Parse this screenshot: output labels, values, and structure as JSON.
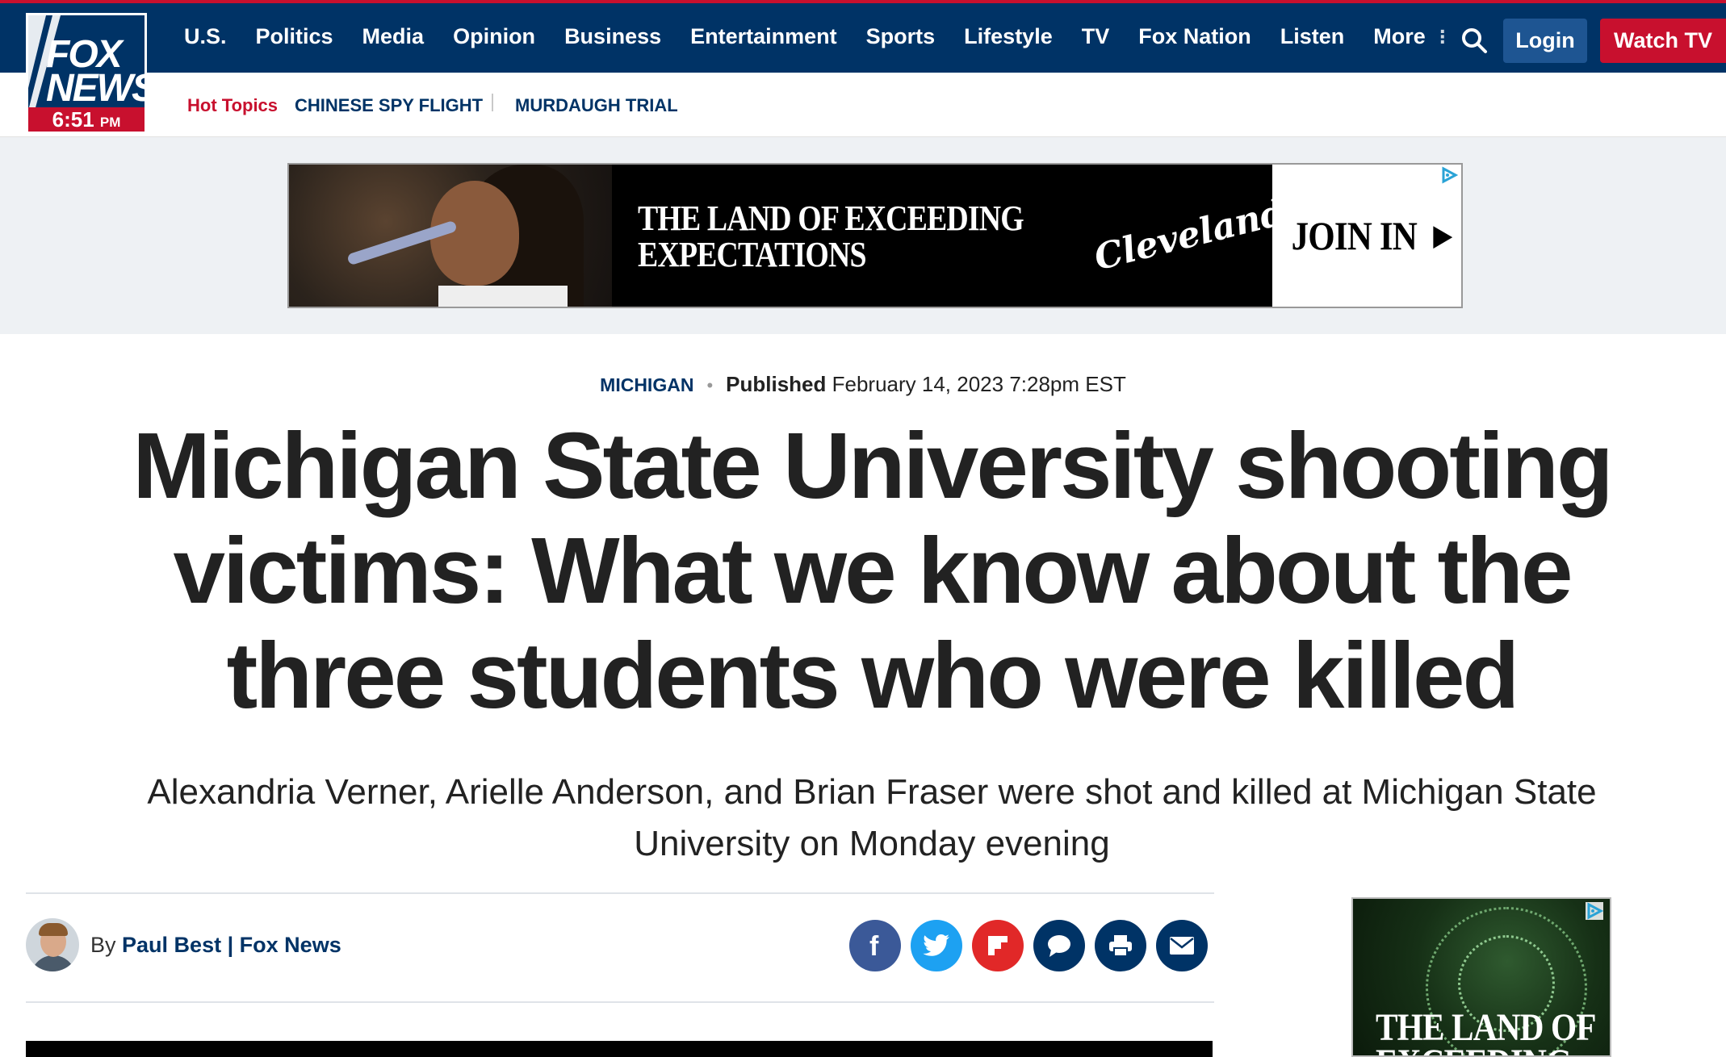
{
  "logo": {
    "line1": "FOX",
    "line2": "NEWS",
    "time": "6:51",
    "ampm": "PM"
  },
  "nav": {
    "items": [
      "U.S.",
      "Politics",
      "Media",
      "Opinion",
      "Business",
      "Entertainment",
      "Sports",
      "Lifestyle",
      "TV",
      "Fox Nation",
      "Listen",
      "More"
    ],
    "login": "Login",
    "watch_tv": "Watch TV",
    "search_icon": "search-icon",
    "more_icon": "vertical-dots-icon"
  },
  "hot_topics": {
    "label": "Hot Topics",
    "items": [
      "CHINESE SPY FLIGHT",
      "MURDAUGH TRIAL"
    ]
  },
  "banner_ad": {
    "headline_line1": "THE LAND OF EXCEEDING",
    "headline_line2": "EXPECTATIONS",
    "brand": "Cleveland",
    "cta": "JOIN IN"
  },
  "article": {
    "category": "MICHIGAN",
    "published_label": "Published",
    "published_date": "February 14, 2023 7:28pm EST",
    "headline": "Michigan State University shooting victims: What we know about the three students who were killed",
    "subheadline": "Alexandria Verner, Arielle Anderson, and Brian Fraser were shot and killed at Michigan State University on Monday evening",
    "byline_prefix": "By",
    "author": "Paul Best",
    "outlet": "Fox News"
  },
  "share_buttons": [
    {
      "name": "facebook",
      "color": "#3b5998"
    },
    {
      "name": "twitter",
      "color": "#1da1f2"
    },
    {
      "name": "flipboard",
      "color": "#e12828"
    },
    {
      "name": "comments",
      "color": "#003366"
    },
    {
      "name": "print",
      "color": "#003366"
    },
    {
      "name": "email",
      "color": "#003366"
    }
  ],
  "side_ad": {
    "line1": "THE LAND OF",
    "line2": "EXCEEDING"
  },
  "colors": {
    "brand_navy": "#003366",
    "brand_red": "#c8102e",
    "login_blue": "#1e5592"
  }
}
